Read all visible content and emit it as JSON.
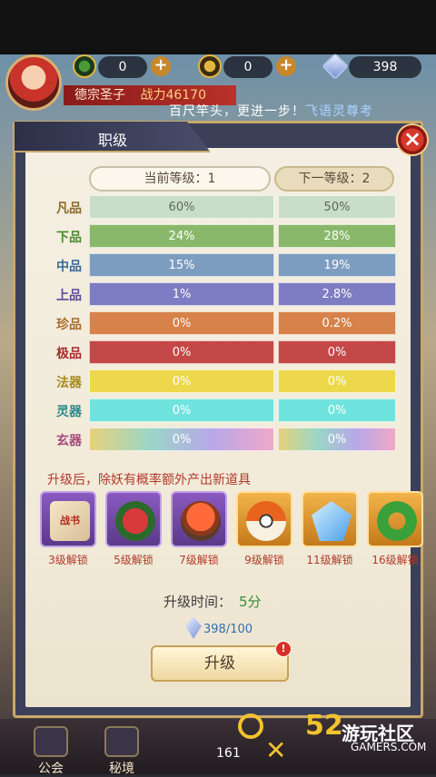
{
  "topbar": {
    "resources": [
      {
        "icon": "jade-coin-icon",
        "value": "0"
      },
      {
        "icon": "gold-coin-icon",
        "value": "0"
      },
      {
        "icon": "crystal-icon",
        "value": "398"
      }
    ],
    "player_name": "德宗圣子",
    "power": "战力46170",
    "tagline_prefix": "百尺竿头，更进一步！",
    "tagline_highlight": "飞语灵尊考"
  },
  "dialog": {
    "title": "职级",
    "current_level_label": "当前等级：1",
    "next_level_label": "下一等级：2",
    "rows": [
      {
        "label": "凡品",
        "label_color": "#8a6a2a",
        "color": "#c9ddc9",
        "text_color": "#5a6a5a",
        "current": "60%",
        "next": "50%"
      },
      {
        "label": "下品",
        "label_color": "#4a8a2a",
        "color": "#8ab86a",
        "text_color": "#ffffff",
        "current": "24%",
        "next": "28%"
      },
      {
        "label": "中品",
        "label_color": "#3a6a9a",
        "color": "#7c9cc0",
        "text_color": "#ffffff",
        "current": "15%",
        "next": "19%"
      },
      {
        "label": "上品",
        "label_color": "#5a4a9a",
        "color": "#7e7cc2",
        "text_color": "#ffffff",
        "current": "1%",
        "next": "2.8%"
      },
      {
        "label": "珍品",
        "label_color": "#a86a2a",
        "color": "#d6824a",
        "text_color": "#ffffff",
        "current": "0%",
        "next": "0.2%"
      },
      {
        "label": "极品",
        "label_color": "#a82a2a",
        "color": "#c44848",
        "text_color": "#ffffff",
        "current": "0%",
        "next": "0%"
      },
      {
        "label": "法器",
        "label_color": "#a88a1a",
        "color": "#ecd84a",
        "text_color": "#ffffff",
        "current": "0%",
        "next": "0%"
      },
      {
        "label": "灵器",
        "label_color": "#2a8a8a",
        "color": "#6fe4de",
        "text_color": "#ffffff",
        "current": "0%",
        "next": "0%"
      },
      {
        "label": "玄器",
        "label_color": "#a84a7a",
        "color": "linear-gradient(90deg,#e6d27a,#9ad6c8,#b8a8e8,#f0a8c8)",
        "text_color": "#ffffff",
        "current": "0%",
        "next": "0%"
      }
    ],
    "promo_text": "升级后，除妖有概率额外产出新道具",
    "items": [
      {
        "icon": "battle-letter-icon",
        "art_text": "战书",
        "frame": "purple",
        "unlock": "3级解锁"
      },
      {
        "icon": "flower-bouquet-icon",
        "art_text": "",
        "frame": "purple",
        "unlock": "5级解锁"
      },
      {
        "icon": "crystal-orb-icon",
        "art_text": "",
        "frame": "purple",
        "unlock": "7级解锁"
      },
      {
        "icon": "capture-ball-icon",
        "art_text": "",
        "frame": "gold",
        "unlock": "9级解锁"
      },
      {
        "icon": "ice-crystal-icon",
        "art_text": "",
        "frame": "gold",
        "unlock": "11级解锁"
      },
      {
        "icon": "jade-ring-icon",
        "art_text": "",
        "frame": "gold",
        "unlock": "16级解锁"
      }
    ],
    "upgrade_time_label": "升级时间：",
    "upgrade_time_value": "5分",
    "cost": "398/100",
    "upgrade_button": "升级",
    "upgrade_badge": "!"
  },
  "bottom_nav": {
    "items": [
      "公会",
      "秘境"
    ],
    "counter": "161"
  },
  "watermark": {
    "number": "52",
    "text": "游玩社区",
    "en": "GAMERS.COM"
  }
}
